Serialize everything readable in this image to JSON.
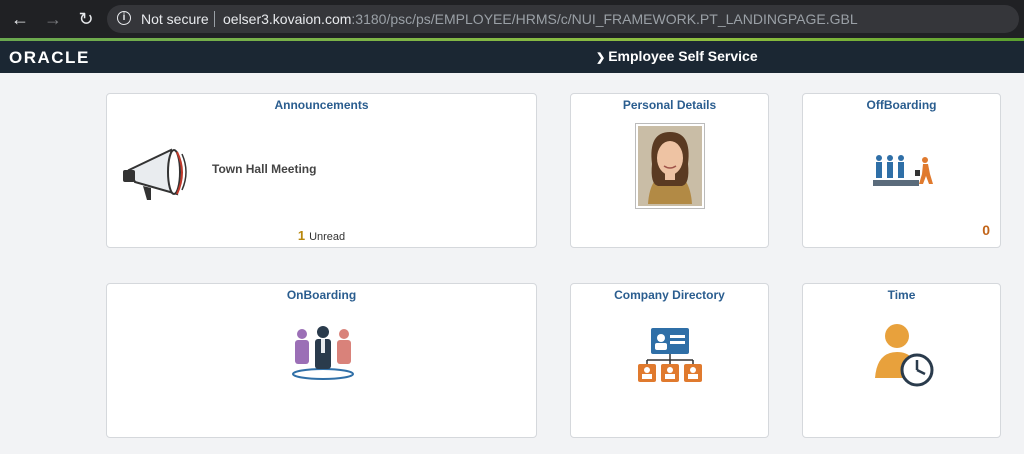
{
  "browser": {
    "security_label": "Not secure",
    "url_host": "oelser3.kovaion.com",
    "url_rest": ":3180/psc/ps/EMPLOYEE/HRMS/c/NUI_FRAMEWORK.PT_LANDINGPAGE.GBL"
  },
  "header": {
    "logo_text": "ORACLE",
    "homepage_title": "Employee Self Service"
  },
  "tiles": [
    {
      "title": "Announcements",
      "item": "Town Hall Meeting",
      "unread_count": "1",
      "unread_label": "Unread"
    },
    {
      "title": "Personal Details"
    },
    {
      "title": "OffBoarding",
      "count": "0"
    },
    {
      "title": "OnBoarding"
    },
    {
      "title": "Company Directory"
    },
    {
      "title": "Time"
    }
  ],
  "colors": {
    "header_bg": "#1b2733",
    "tile_title": "#2a5d8f",
    "accent_orange": "#e07a2e",
    "accent_blue": "#2f6fa7"
  }
}
